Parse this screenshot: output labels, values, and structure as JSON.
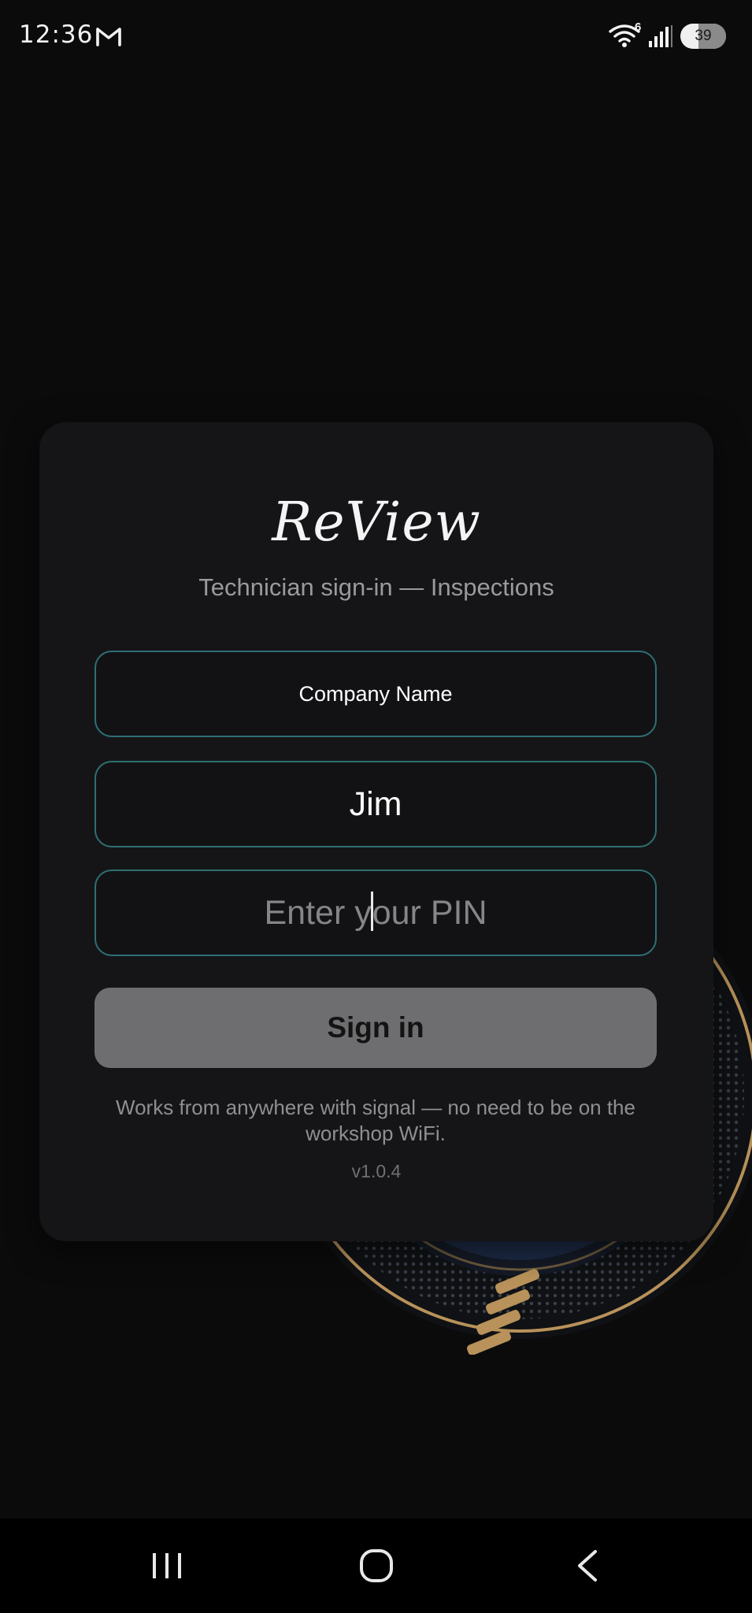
{
  "status_bar": {
    "time": "12:36",
    "wifi_badge": "6",
    "battery_level": "39",
    "icons": [
      "gmail-icon",
      "wifi-icon",
      "signal-icon",
      "battery-icon"
    ]
  },
  "card": {
    "logo_text": "ReView",
    "subtitle": "Technician sign-in — Inspections",
    "company_field": {
      "value": "Company Name"
    },
    "name_field": {
      "value": "Jim"
    },
    "pin_field": {
      "placeholder_before_caret": "Enter y",
      "placeholder_after_caret": "our PIN"
    },
    "sign_in_label": "Sign in",
    "footnote": "Works from anywhere with signal — no need to be on the workshop WiFi.",
    "version": "v1.0.4"
  },
  "nav_bar": {
    "icons": [
      "recents-icon",
      "home-icon",
      "back-icon"
    ]
  },
  "colors": {
    "background": "#0b0b0c",
    "card": "#151517",
    "field_border": "#2e6f74",
    "button": "#6e6e70",
    "emblem_gold": "#b8925a",
    "emblem_blue": "#1c2a44"
  }
}
